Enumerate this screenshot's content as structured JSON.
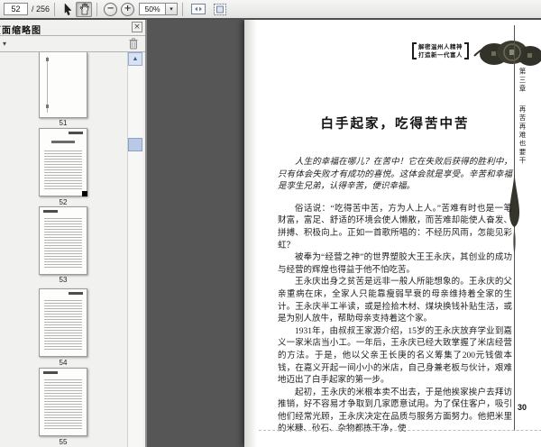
{
  "toolbar": {
    "page_input": "52",
    "page_total_label": "/ 256",
    "zoom_value": "50%",
    "minus_glyph": "−",
    "plus_glyph": "+",
    "zoom_dropdown_glyph": "▾"
  },
  "sidebar": {
    "panel_title": "页面缩略图",
    "close_glyph": "×",
    "options_glyph": "▾",
    "scroll_up_glyph": "▲",
    "thumbnails": [
      {
        "label": "51"
      },
      {
        "label": "52"
      },
      {
        "label": "53"
      },
      {
        "label": "54"
      },
      {
        "label": "55"
      }
    ]
  },
  "page": {
    "header_banner_line1": "解密温州人精神",
    "header_banner_line2": "打造新一代富人",
    "chapter_label": "第三章",
    "chapter_title": "再苦再难也要干",
    "title": "白手起家，吃得苦中苦",
    "paragraphs": [
      "人生的幸福在哪儿？在苦中！它在失败后获得的胜利中，只有体会失败才有成功的喜悦。这体会就是享受。辛苦和幸福是孪生兄弟，认得辛苦，便识幸福。",
      "俗话说：“吃得苦中苦，方为人上人。”苦难有时也是一笔财富，富足、舒适的环境会使人懒散，而苦难却能使人奋发、拼搏、积极向上。正如一首歌所唱的：不经历风雨，怎能见彩虹？",
      "被奉为“经营之神”的世界塑胶大王王永庆，其创业的成功与经营的辉煌也得益于他不怕吃苦。",
      "王永庆出身之贫苦是远非一般人所能想象的。王永庆的父亲重病在床，全家人只能靠瘦弱早衰的母亲维持着全家的生计。王永庆半工半读，或是捡拾木材、煤块换钱补贴生活，或是为别人放牛，帮助母亲支持着这个家。",
      "1931年，由叔叔王家源介绍，15岁的王永庆放弃学业到嘉义一家米店当小工。一年后，王永庆已经大致掌握了米店经营的方法。于是，他以父亲王长庚的名义筹集了200元钱做本钱，在嘉义开起一间小小的米店，自己身兼老板与伙计，艰难地迈出了白手起家的第一步。",
      "起初，王永庆的米根本卖不出去，于是他挨家挨户去拜访推销，好不容易才争取到几家愿意试用。为了保住客户，吸引他们经常光顾，王永庆决定在品质与服务方面努力。他把米里的米糠、砂石、杂物都拣干净，使"
    ],
    "page_number": "30"
  },
  "colors": {
    "canvas_background": "#565656",
    "toolbar_background": "#ececea",
    "scroll_thumb": "#b9c9e6"
  }
}
